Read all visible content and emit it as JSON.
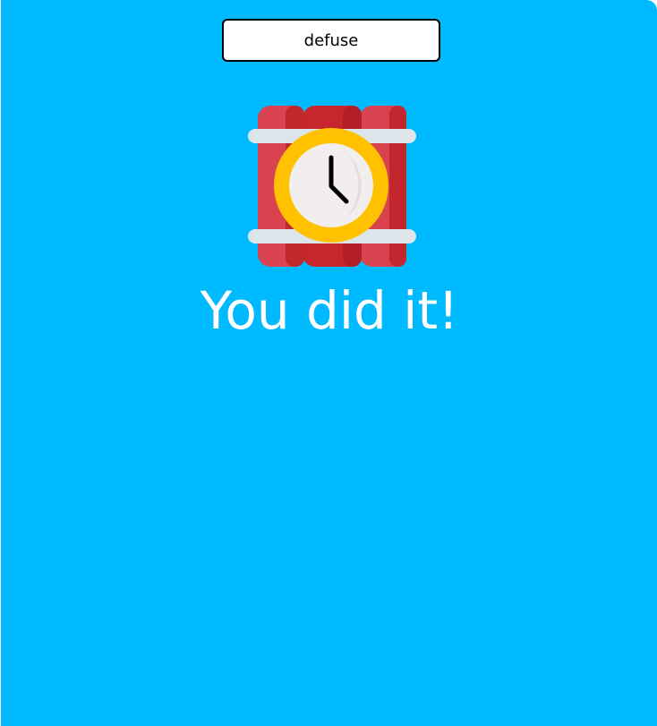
{
  "game": {
    "defuse_button_label": "defuse",
    "result_message": "You did it!",
    "icon": "time-bomb-icon"
  },
  "colors": {
    "background": "#00baff",
    "button_bg": "#ffffff",
    "button_border": "#000000",
    "message_text": "#ffffff",
    "dynamite_red": "#d8434f",
    "dynamite_dark": "#c1272d",
    "strap": "#dce6ea",
    "clock_ring": "#ffc100",
    "clock_face": "#f3eeee"
  }
}
